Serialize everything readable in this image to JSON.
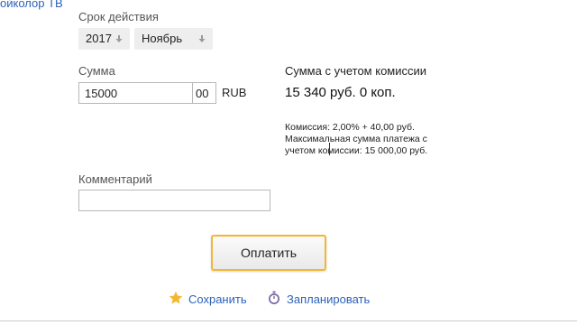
{
  "header": {
    "top_link": "ойколор ТВ"
  },
  "validity": {
    "label": "Срок действия",
    "year": "2017",
    "month": "Ноябрь"
  },
  "amount": {
    "label": "Сумма",
    "rubles": "15000",
    "kopecks": "00",
    "currency": "RUB"
  },
  "commission": {
    "heading": "Сумма с учетом комиссии",
    "total": "15 340 руб. 0 коп.",
    "line1": "Комиссия: 2,00% + 40,00 руб.",
    "line2": "Максимальная сумма платежа с",
    "line3": "учетом комиссии: 15 000,00 руб."
  },
  "comment": {
    "label": "Комментарий",
    "value": ""
  },
  "actions": {
    "pay": "Оплатить",
    "save": "Сохранить",
    "schedule": "Запланировать"
  },
  "icons": {
    "dropdown": "arrow-down-icon",
    "save": "star-icon",
    "schedule": "stopwatch-icon"
  },
  "colors": {
    "link": "#2b63b8",
    "button_border": "#f4b731",
    "star": "#f4b731",
    "stopwatch": "#7a6aa8"
  }
}
